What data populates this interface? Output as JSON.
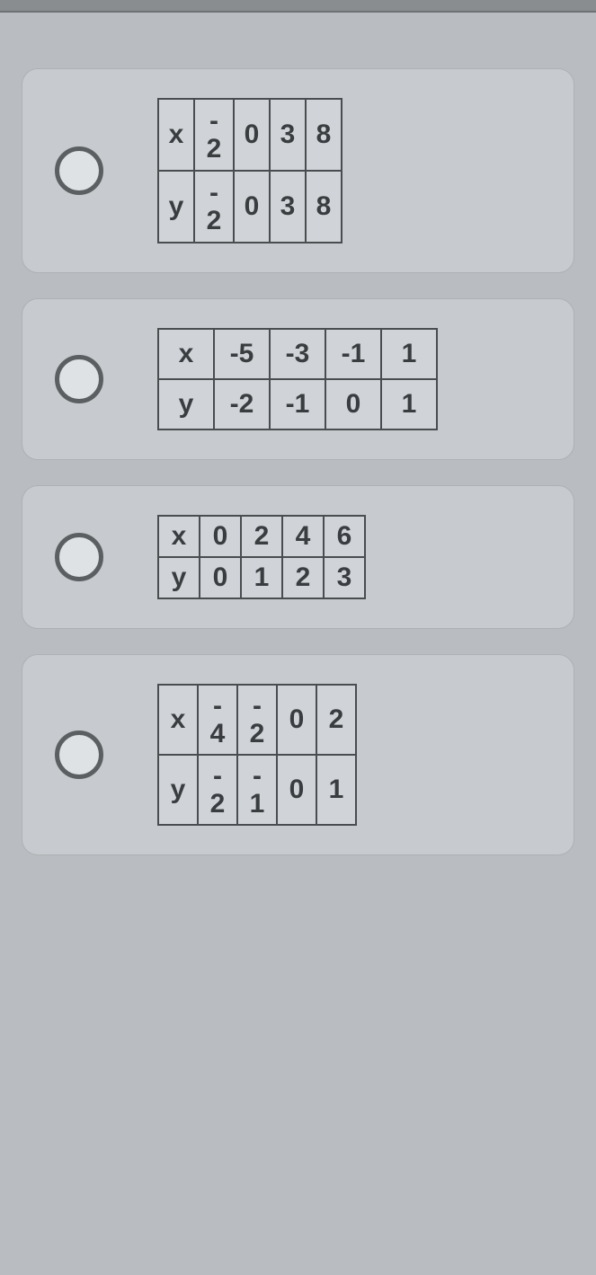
{
  "options": [
    {
      "id": "a",
      "rows": [
        {
          "label": "x",
          "cells": [
            "-\n2",
            "0",
            "3",
            "8"
          ]
        },
        {
          "label": "y",
          "cells": [
            "-\n2",
            "0",
            "3",
            "8"
          ]
        }
      ],
      "chart_data": {
        "type": "table",
        "x": [
          -2,
          0,
          3,
          8
        ],
        "y": [
          -2,
          0,
          3,
          8
        ]
      }
    },
    {
      "id": "b",
      "rows": [
        {
          "label": "x",
          "cells": [
            "-5",
            "-3",
            "-1",
            "1"
          ]
        },
        {
          "label": "y",
          "cells": [
            "-2",
            "-1",
            "0",
            "1"
          ]
        }
      ],
      "chart_data": {
        "type": "table",
        "x": [
          -5,
          -3,
          -1,
          1
        ],
        "y": [
          -2,
          -1,
          0,
          1
        ]
      }
    },
    {
      "id": "c",
      "rows": [
        {
          "label": "x",
          "cells": [
            "0",
            "2",
            "4",
            "6"
          ]
        },
        {
          "label": "y",
          "cells": [
            "0",
            "1",
            "2",
            "3"
          ]
        }
      ],
      "chart_data": {
        "type": "table",
        "x": [
          0,
          2,
          4,
          6
        ],
        "y": [
          0,
          1,
          2,
          3
        ]
      }
    },
    {
      "id": "d",
      "rows": [
        {
          "label": "x",
          "cells": [
            "-\n4",
            "-\n2",
            "0",
            "2"
          ]
        },
        {
          "label": "y",
          "cells": [
            "-\n2",
            "-\n1",
            "0",
            "1"
          ]
        }
      ],
      "chart_data": {
        "type": "table",
        "x": [
          -4,
          -2,
          0,
          2
        ],
        "y": [
          -2,
          -1,
          0,
          1
        ]
      }
    }
  ]
}
